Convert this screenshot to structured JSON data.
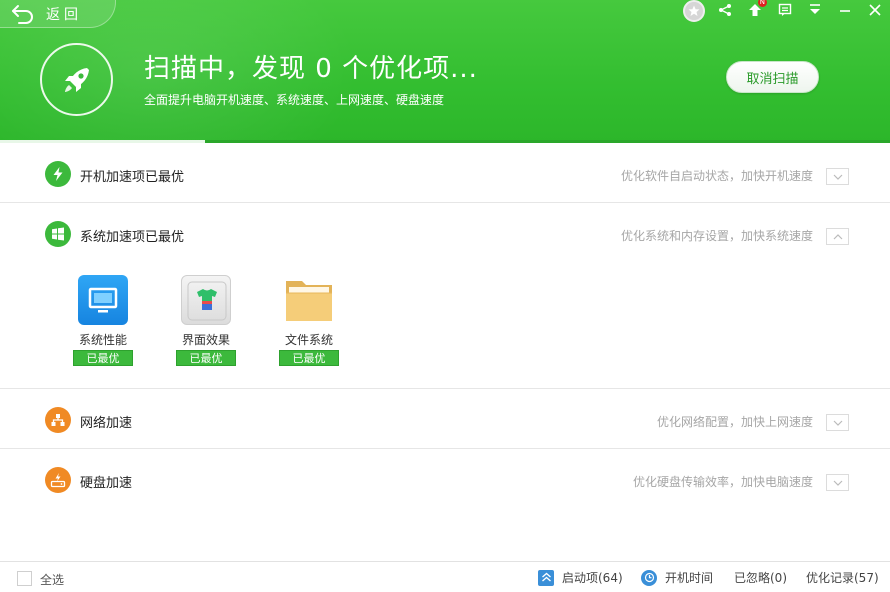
{
  "header": {
    "back_label": "返回",
    "scan_title": "扫描中，发现 0 个优化项...",
    "scan_subtitle": "全面提升电脑开机速度、系统速度、上网速度、硬盘速度",
    "cancel_label": "取消扫描",
    "notification_badge": "N",
    "progress_fraction": 0.23
  },
  "sections": [
    {
      "title": "开机加速项已最优",
      "desc": "优化软件自启动状态，加快开机速度",
      "icon": "lightning-icon",
      "color": "#3cb93c",
      "expanded": false
    },
    {
      "title": "系统加速项已最优",
      "desc": "优化系统和内存设置，加快系统速度",
      "icon": "windows-icon",
      "color": "#3cb93c",
      "expanded": true,
      "items": [
        {
          "label": "系统性能",
          "status": "已最优",
          "icon": "monitor-icon"
        },
        {
          "label": "界面效果",
          "status": "已最优",
          "icon": "shirt-icon"
        },
        {
          "label": "文件系统",
          "status": "已最优",
          "icon": "folder-icon"
        }
      ]
    },
    {
      "title": "网络加速",
      "desc": "优化网络配置，加快上网速度",
      "icon": "network-icon",
      "color": "#f08a24",
      "expanded": false
    },
    {
      "title": "硬盘加速",
      "desc": "优化硬盘传输效率，加快电脑速度",
      "icon": "harddisk-icon",
      "color": "#f08a24",
      "expanded": false
    }
  ],
  "footer": {
    "select_all": "全选",
    "startup_items": "启动项(64)",
    "boot_time": "开机时间",
    "ignored": "已忽略(0)",
    "history": "优化记录(57)"
  }
}
